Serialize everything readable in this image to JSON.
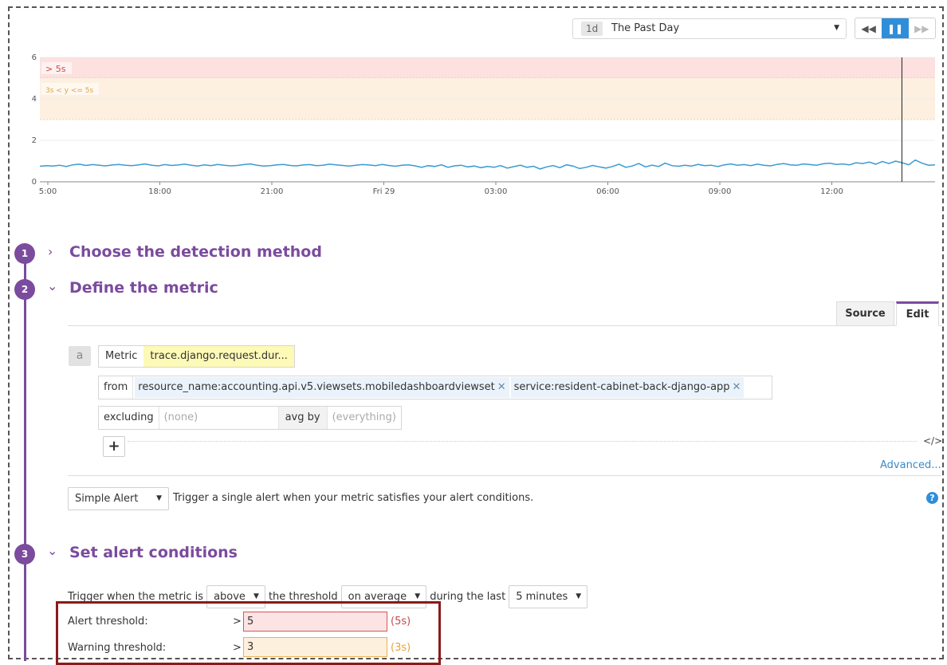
{
  "timeframe": {
    "badge": "1d",
    "label": "The Past Day"
  },
  "playback": {
    "rewind_icon": "fast-backward-icon",
    "pause_icon": "pause-icon",
    "forward_icon": "fast-forward-icon"
  },
  "chart_data": {
    "type": "line",
    "y_ticks": [
      "0",
      "2",
      "4",
      "6"
    ],
    "ylim": [
      0,
      6
    ],
    "x_ticks": [
      "5:00",
      "18:00",
      "21:00",
      "Fri 29",
      "03:00",
      "06:00",
      "09:00",
      "12:00"
    ],
    "bands": [
      {
        "label": "> 5s",
        "from": 5,
        "to": 6,
        "color": "#fde0e0"
      },
      {
        "label": "3s < y <= 5s",
        "from": 3,
        "to": 5,
        "color": "#fdf0e0"
      }
    ],
    "series": [
      {
        "color": "#3a9bd1",
        "values": [
          0.75,
          0.78,
          0.76,
          0.8,
          0.74,
          0.82,
          0.85,
          0.79,
          0.83,
          0.8,
          0.77,
          0.81,
          0.84,
          0.8,
          0.78,
          0.82,
          0.86,
          0.8,
          0.77,
          0.83,
          0.79,
          0.81,
          0.85,
          0.8,
          0.76,
          0.82,
          0.78,
          0.84,
          0.8,
          0.77,
          0.79,
          0.83,
          0.86,
          0.8,
          0.76,
          0.78,
          0.82,
          0.84,
          0.79,
          0.77,
          0.81,
          0.83,
          0.78,
          0.8,
          0.85,
          0.82,
          0.79,
          0.76,
          0.8,
          0.83,
          0.81,
          0.78,
          0.84,
          0.79,
          0.75,
          0.8,
          0.82,
          0.77,
          0.7,
          0.78,
          0.74,
          0.82,
          0.7,
          0.77,
          0.8,
          0.72,
          0.76,
          0.68,
          0.74,
          0.7,
          0.78,
          0.66,
          0.73,
          0.8,
          0.7,
          0.75,
          0.62,
          0.72,
          0.78,
          0.68,
          0.82,
          0.76,
          0.64,
          0.7,
          0.79,
          0.72,
          0.66,
          0.74,
          0.85,
          0.7,
          0.76,
          0.88,
          0.72,
          0.8,
          0.74,
          0.9,
          0.78,
          0.75,
          0.8,
          0.76,
          0.84,
          0.78,
          0.8,
          0.74,
          0.82,
          0.86,
          0.8,
          0.83,
          0.78,
          0.85,
          0.8,
          0.77,
          0.84,
          0.88,
          0.82,
          0.8,
          0.86,
          0.83,
          0.8,
          0.87,
          0.9,
          0.84,
          0.86,
          0.82,
          0.92,
          0.88,
          0.95,
          0.85,
          0.98,
          0.88,
          1.0,
          0.92,
          0.82,
          1.05,
          0.9,
          0.8,
          0.82
        ]
      }
    ],
    "marker_fraction": 0.963
  },
  "steps": [
    {
      "number": "1",
      "title": "Choose the detection method",
      "chevron": ">"
    },
    {
      "number": "2",
      "title": "Define the metric",
      "chevron": "v"
    },
    {
      "number": "3",
      "title": "Set alert conditions",
      "chevron": "v"
    }
  ],
  "editor": {
    "tab_source": "Source",
    "tab_edit": "Edit",
    "query_letter": "a",
    "metric_label": "Metric",
    "metric_value": "trace.django.request.dur...",
    "from_label": "from",
    "tags": [
      "resource_name:accounting.api.v5.viewsets.mobiledashboardviewset",
      "service:resident-cabinet-back-django-app"
    ],
    "excluding_label": "excluding",
    "excluding_placeholder": "(none)",
    "avgby_label": "avg by",
    "avgby_placeholder": "(everything)",
    "add_symbol": "+",
    "code_toggle": "</>",
    "advanced": "Advanced..."
  },
  "alert_type": {
    "value": "Simple Alert",
    "description": "Trigger a single alert when your metric satisfies your alert conditions.",
    "help": "?"
  },
  "conditions": {
    "prefix": "Trigger when the metric is",
    "comparator": "above",
    "mid": "the threshold",
    "aggregation": "on average",
    "during": "during the last",
    "window": "5 minutes",
    "alert_label": "Alert threshold:",
    "alert_op": ">",
    "alert_value": "5",
    "alert_hint": "(5s)",
    "warning_label": "Warning threshold:",
    "warning_op": ">",
    "warning_value": "3",
    "warning_hint": "(3s)",
    "alert_color": "#c94848",
    "warning_color": "#e3a33a"
  }
}
